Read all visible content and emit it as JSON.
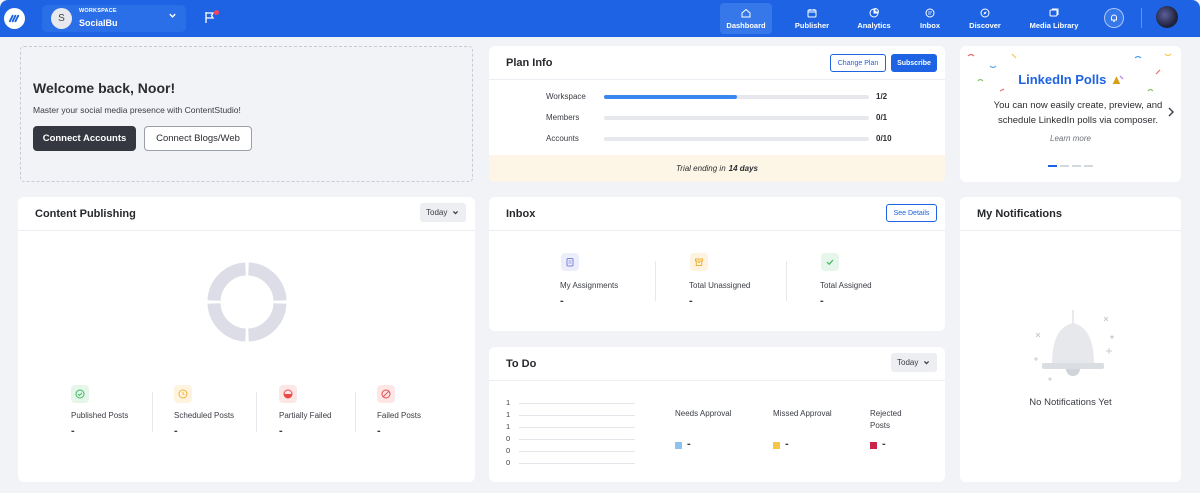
{
  "header": {
    "workspace_label": "WORKSPACE",
    "workspace_name": "SocialBu",
    "workspace_initial": "S",
    "nav": [
      {
        "label": "Dashboard",
        "active": true
      },
      {
        "label": "Publisher"
      },
      {
        "label": "Analytics"
      },
      {
        "label": "Inbox"
      },
      {
        "label": "Discover"
      },
      {
        "label": "Media Library"
      }
    ]
  },
  "welcome": {
    "title": "Welcome back, Noor!",
    "subtitle": "Master your social media presence with ContentStudio!",
    "connect_accounts": "Connect Accounts",
    "connect_blogs": "Connect Blogs/Web"
  },
  "plan_info": {
    "title": "Plan Info",
    "change_plan": "Change Plan",
    "subscribe": "Subscribe",
    "rows": [
      {
        "label": "Workspace",
        "value": "1/2",
        "fill": 0.5
      },
      {
        "label": "Members",
        "value": "0/1",
        "fill": 0
      },
      {
        "label": "Accounts",
        "value": "0/10",
        "fill": 0
      }
    ],
    "trial_prefix": "Trial ending in",
    "trial_days": "14 days"
  },
  "promo": {
    "title": "LinkedIn Polls",
    "text": "You can now easily create, preview, and schedule LinkedIn polls via composer.",
    "learn_more": "Learn more"
  },
  "content_publishing": {
    "title": "Content Publishing",
    "range": "Today",
    "stats": [
      {
        "label": "Published Posts",
        "value": "-",
        "color": "#3dba5e"
      },
      {
        "label": "Scheduled Posts",
        "value": "-",
        "color": "#f0b43a"
      },
      {
        "label": "Partially Failed",
        "value": "-",
        "color": "#e84a4a"
      },
      {
        "label": "Failed Posts",
        "value": "-",
        "color": "#e84a4a"
      }
    ]
  },
  "inbox": {
    "title": "Inbox",
    "see_details": "See Details",
    "stats": [
      {
        "label": "My Assignments",
        "value": "-"
      },
      {
        "label": "Total Unassigned",
        "value": "-"
      },
      {
        "label": "Total Assigned",
        "value": "-"
      }
    ]
  },
  "todo": {
    "title": "To Do",
    "range": "Today",
    "yticks": [
      "1",
      "1",
      "1",
      "0",
      "0",
      "0"
    ],
    "legend": [
      {
        "label": "Needs Approval",
        "value": "-",
        "color": "#8fc3ef"
      },
      {
        "label": "Missed Approval",
        "value": "-",
        "color": "#f5c744"
      },
      {
        "label": "Rejected Posts",
        "value": "-",
        "color": "#c9254a"
      }
    ]
  },
  "notifications": {
    "title": "My Notifications",
    "empty": "No Notifications Yet"
  }
}
